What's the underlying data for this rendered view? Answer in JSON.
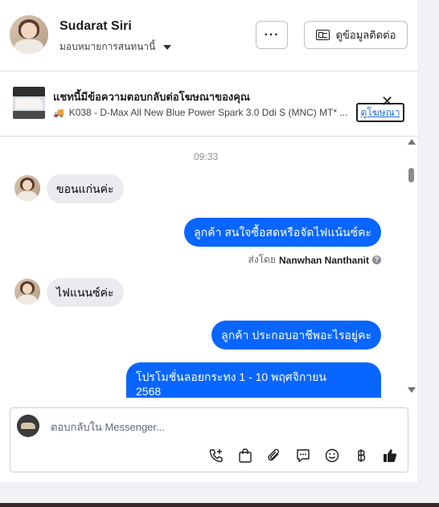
{
  "contact": {
    "name": "Sudarat Siri",
    "assignment": "มอบหมายการสนทนานี้"
  },
  "header": {
    "more_label": "···",
    "info_label": "ดูข้อมูลติดต่อ"
  },
  "ad": {
    "title": "แชทนี้มีข้อความตอบกลับต่อโฆษณาของคุณ",
    "subtitle": "K038 - D-Max All New Blue Power Spark 3.0 Ddi S (MNC) MT* ...",
    "view_label": "ดูโฆษณา",
    "close_glyph": "✕"
  },
  "thread": {
    "timestamp": "09:33",
    "messages": [
      {
        "direction": "in",
        "text": "ขอนแก่นค่ะ"
      },
      {
        "direction": "out",
        "text": "ลูกค้า สนใจซื้อสดหรือจัดไฟแน้นซ์คะ"
      },
      {
        "direction": "in",
        "text": "ไฟแนนซ์ค่ะ"
      },
      {
        "direction": "out",
        "text": "ลูกค้า  ประกอบอาชีพอะไรอยู่คะ"
      },
      {
        "direction": "out",
        "text": "โปรโมชั่นลอยกระทง 1 - 10 พฤศจิกายน",
        "text2": "2568"
      }
    ],
    "sent_by_prefix": "ส่งโดย",
    "sent_by_name": "Nanwhan Nanthanit",
    "help_glyph": "?"
  },
  "composer": {
    "placeholder": "ตอบกลับใน Messenger...",
    "tools": [
      "call-add-icon",
      "shopping-bag-icon",
      "paperclip-icon",
      "chat-bubble-icon",
      "emoji-icon",
      "baht-icon",
      "thumbs-up-icon"
    ]
  },
  "colors": {
    "outgoing_bubble": "#0866ff",
    "incoming_bubble": "#e9ebee",
    "link": "#216fdb"
  }
}
